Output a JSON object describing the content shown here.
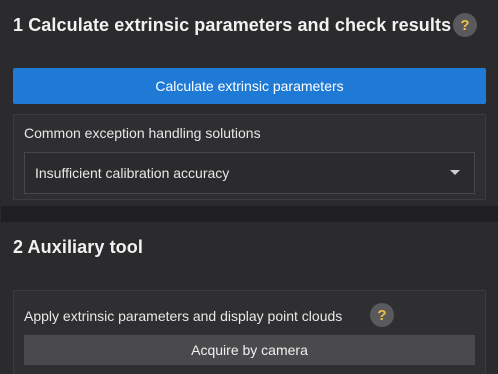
{
  "section1": {
    "title": "1 Calculate extrinsic parameters and check results",
    "help": "?",
    "calculate_button": "Calculate extrinsic parameters",
    "exceptions": {
      "label": "Common exception handling solutions",
      "selected": "Insufficient calibration accuracy"
    }
  },
  "section2": {
    "title": "2 Auxiliary tool",
    "apply": {
      "label": "Apply extrinsic parameters and display point clouds",
      "help": "?",
      "acquire_button": "Acquire by camera"
    }
  },
  "colors": {
    "accent": "#1f7ad6",
    "help_question": "#f0c040"
  },
  "icons": [
    "help-icon",
    "chevron-down-icon"
  ]
}
